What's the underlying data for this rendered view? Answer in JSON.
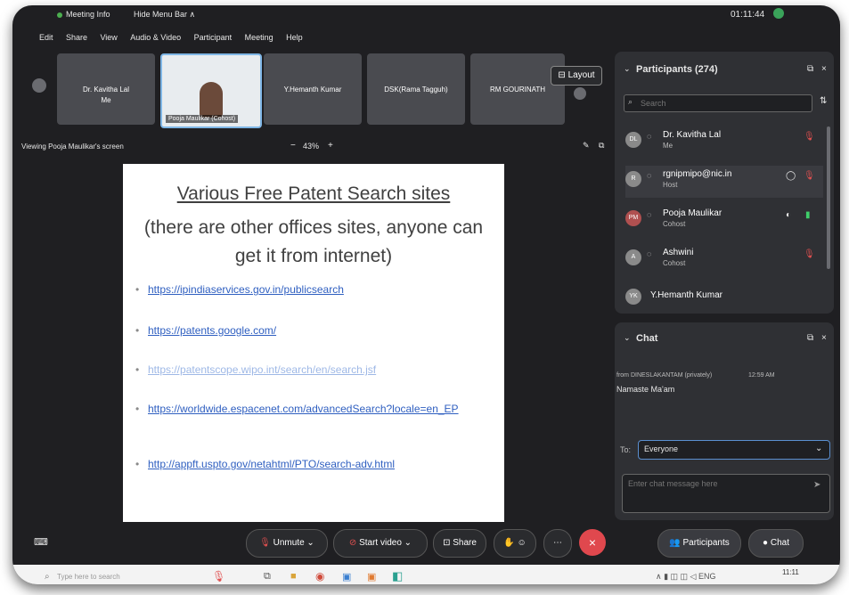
{
  "window": {
    "title": "Meeting Info",
    "hide_menu": "Hide Menu Bar ∧",
    "time": "01:11:44"
  },
  "menu": [
    "Edit",
    "Share",
    "View",
    "Audio & Video",
    "Participant",
    "Meeting",
    "Help"
  ],
  "thumbnails": [
    {
      "name": "Dr. Kavitha Lal",
      "sub": "Me"
    },
    {
      "name": "Pooja Maulikar (Cohost)",
      "sub": ""
    },
    {
      "name": "Y.Hemanth Kumar",
      "sub": ""
    },
    {
      "name": "DSK(Rama Tagguh)",
      "sub": ""
    },
    {
      "name": "RM GOURINATH",
      "sub": ""
    }
  ],
  "layout_label": "Layout",
  "viewing_label": "Viewing Pooja Maulikar's screen",
  "zoom": "43%",
  "slide": {
    "title": "Various Free Patent Search sites",
    "subtitle": "(there are other offices sites, anyone can get it from internet)",
    "links": [
      "https://ipindiaservices.gov.in/publicsearch",
      "https://patents.google.com/",
      "https://patentscope.wipo.int/search/en/search.jsf",
      "https://worldwide.espacenet.com/advancedSearch?locale=en_EP",
      "http://appft.uspto.gov/netahtml/PTO/search-adv.html"
    ]
  },
  "participants": {
    "header": "Participants (274)",
    "search_placeholder": "Search",
    "list": [
      {
        "name": "Dr. Kavitha Lal",
        "role": "Me",
        "initials": "DL",
        "color": "#7a7a7a"
      },
      {
        "name": "rgnipmipo@nic.in",
        "role": "Host",
        "initials": "R",
        "color": "#7a7a7a"
      },
      {
        "name": "Pooja Maulikar",
        "role": "Cohost",
        "initials": "PM",
        "color": "#b05050"
      },
      {
        "name": "Ashwini",
        "role": "Cohost",
        "initials": "A",
        "color": "#7a7a7a"
      },
      {
        "name": "Y.Hemanth Kumar",
        "role": "",
        "initials": "YK",
        "color": "#7a7a7a"
      }
    ]
  },
  "chat": {
    "header": "Chat",
    "message_from": "from DINESLAKANTAM (privately)",
    "message_time": "12:59 AM",
    "message_text": "Namaste Ma'am",
    "to_label": "To:",
    "recipient": "Everyone",
    "placeholder": "Enter chat message here"
  },
  "controls": {
    "unmute": "Unmute",
    "start_video": "Start video",
    "share": "Share",
    "participants": "Participants",
    "chat": "Chat"
  },
  "taskbar": {
    "search_placeholder": "Type here to search",
    "clock": "11:11"
  }
}
